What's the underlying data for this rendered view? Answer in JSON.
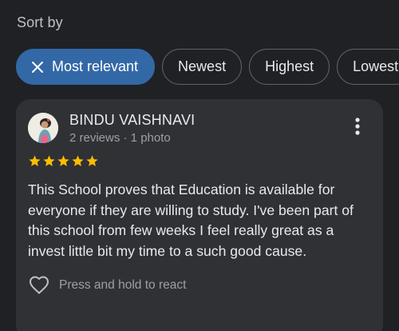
{
  "sort": {
    "label": "Sort by",
    "chips": [
      {
        "label": "Most relevant",
        "selected": true,
        "icon": "close-icon"
      },
      {
        "label": "Newest",
        "selected": false
      },
      {
        "label": "Highest",
        "selected": false
      },
      {
        "label": "Lowest",
        "selected": false
      }
    ]
  },
  "review": {
    "reviewer_name": "BINDU VAISHNAVI",
    "meta": "2 reviews · 1 photo",
    "rating": 5,
    "max_rating": 5,
    "text": "This School proves that Education is available for everyone if they are willing to study. I've been part of this school from few weeks I feel really great as a invest little bit my time to a such good cause.",
    "react_label": "Press and hold to react",
    "icons": {
      "avatar": "avatar",
      "more": "more-vert-icon",
      "star": "star-icon",
      "react": "heart-icon"
    }
  },
  "colors": {
    "background": "#202124",
    "card": "#303134",
    "selected_chip": "#3368a6",
    "star": "#fbbc04",
    "muted_text": "#9aa0a6"
  }
}
